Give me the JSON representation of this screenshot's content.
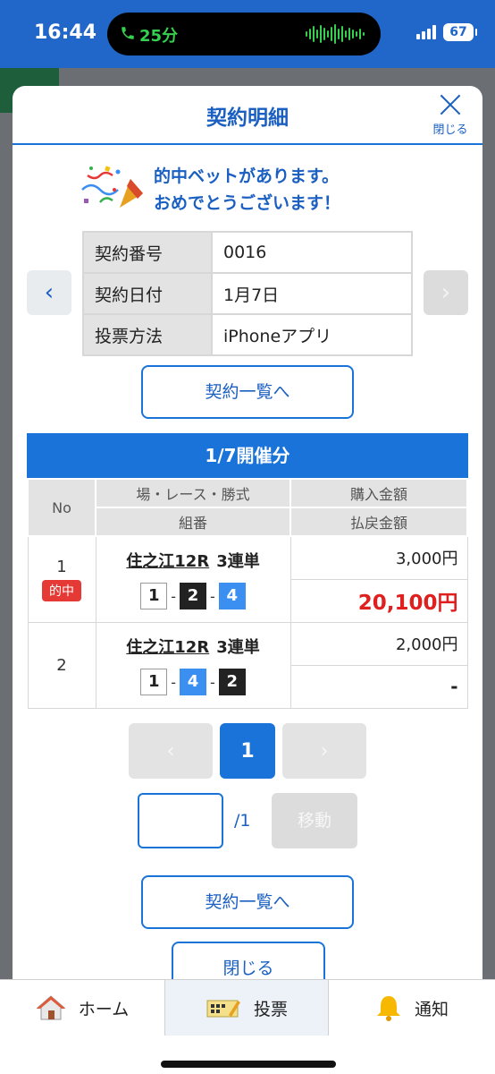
{
  "status": {
    "time": "16:44",
    "call_duration": "25分",
    "battery": "67"
  },
  "modal": {
    "title": "契約明細",
    "close_label": "閉じる",
    "congrats_line1": "的中ベットがあります。",
    "congrats_line2": "おめでとうございます！",
    "info": [
      {
        "key": "契約番号",
        "value": "0016"
      },
      {
        "key": "契約日付",
        "value": "1月7日"
      },
      {
        "key": "投票方法",
        "value": "iPhoneアプリ"
      }
    ],
    "list_button": "契約一覧へ",
    "day_header": "1/7開催分",
    "columns": {
      "no": "No",
      "race": "場・レース・勝式",
      "combo": "組番",
      "purchase": "購入金額",
      "payout": "払戻金額"
    },
    "bets": [
      {
        "no": "1",
        "hit_badge": "的中",
        "race": "住之江12R",
        "type": "3連単",
        "combo": [
          "1",
          "2",
          "4"
        ],
        "purchase": "3,000円",
        "payout": "20,100円"
      },
      {
        "no": "2",
        "race": "住之江12R",
        "type": "3連単",
        "combo": [
          "1",
          "4",
          "2"
        ],
        "purchase": "2,000円",
        "payout": "-"
      }
    ],
    "pagination": {
      "current": "1",
      "total": "/1",
      "move_label": "移動"
    },
    "close_button": "閉じる"
  },
  "tabs": [
    {
      "label": "ホーム",
      "icon": "home-icon"
    },
    {
      "label": "投票",
      "icon": "ticket-icon"
    },
    {
      "label": "通知",
      "icon": "bell-icon"
    }
  ],
  "colors": {
    "accent": "#1a73d9",
    "hit": "#e0201f"
  }
}
